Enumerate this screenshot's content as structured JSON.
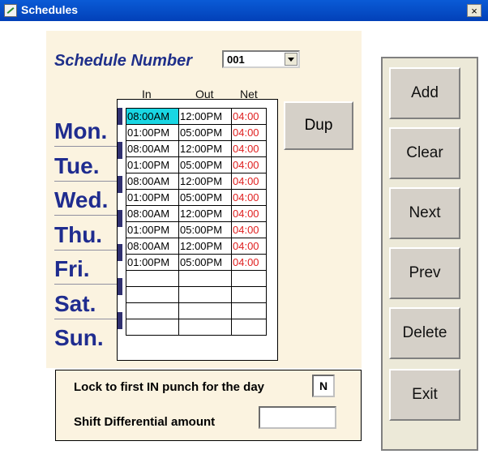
{
  "window": {
    "title": "Schedules",
    "close_label": "×"
  },
  "schedule": {
    "label": "Schedule Number",
    "selected": "001"
  },
  "columns": {
    "in": "In",
    "out": "Out",
    "net": "Net"
  },
  "days": [
    "Mon.",
    "Tue.",
    "Wed.",
    "Thu.",
    "Fri.",
    "Sat.",
    "Sun."
  ],
  "rows": [
    {
      "in": "08:00AM",
      "out": "12:00PM",
      "net": "04:00"
    },
    {
      "in": "01:00PM",
      "out": "05:00PM",
      "net": "04:00"
    },
    {
      "in": "08:00AM",
      "out": "12:00PM",
      "net": "04:00"
    },
    {
      "in": "01:00PM",
      "out": "05:00PM",
      "net": "04:00"
    },
    {
      "in": "08:00AM",
      "out": "12:00PM",
      "net": "04:00"
    },
    {
      "in": "01:00PM",
      "out": "05:00PM",
      "net": "04:00"
    },
    {
      "in": "08:00AM",
      "out": "12:00PM",
      "net": "04:00"
    },
    {
      "in": "01:00PM",
      "out": "05:00PM",
      "net": "04:00"
    },
    {
      "in": "08:00AM",
      "out": "12:00PM",
      "net": "04:00"
    },
    {
      "in": "01:00PM",
      "out": "05:00PM",
      "net": "04:00"
    },
    {
      "in": "",
      "out": "",
      "net": ""
    },
    {
      "in": "",
      "out": "",
      "net": ""
    },
    {
      "in": "",
      "out": "",
      "net": ""
    },
    {
      "in": "",
      "out": "",
      "net": ""
    }
  ],
  "dup_label": "Dup",
  "lock": {
    "label": "Lock to first IN punch for the day",
    "value": "N"
  },
  "shift": {
    "label": "Shift Differential amount",
    "value": ""
  },
  "buttons": {
    "add": "Add",
    "clear": "Clear",
    "next": "Next",
    "prev": "Prev",
    "delete": "Delete",
    "exit": "Exit"
  },
  "colors": {
    "title_bar": "#0a5bd6",
    "panel_bg": "#fbf3e0",
    "day_text": "#1f2c8f",
    "net_text": "#e02020",
    "selected_cell": "#19d6e3"
  }
}
